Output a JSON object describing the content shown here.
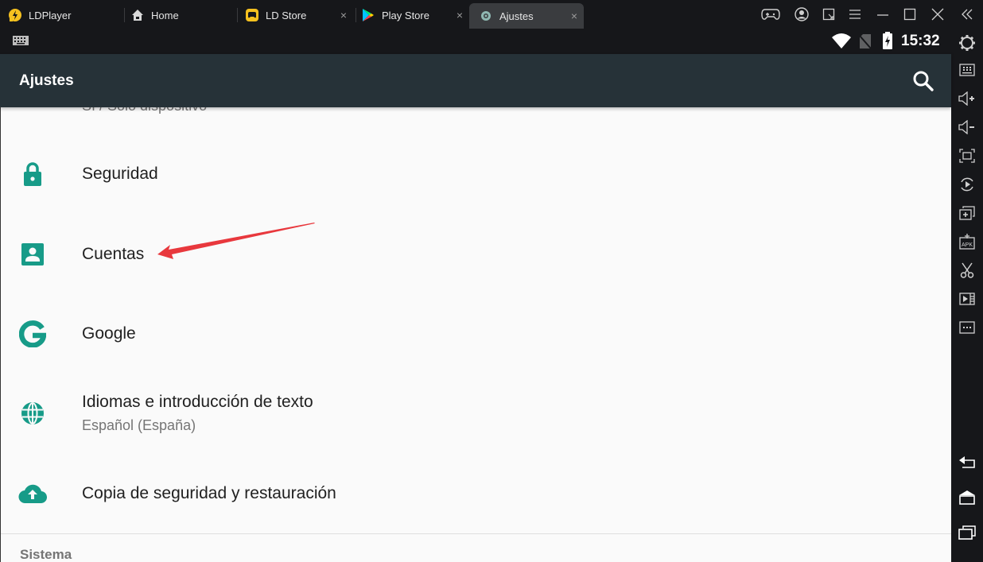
{
  "window": {
    "tabs": [
      {
        "label": "LDPlayer",
        "icon": "ldplayer-logo",
        "closable": false,
        "active": false
      },
      {
        "label": "Home",
        "icon": "home-icon",
        "closable": false,
        "active": false
      },
      {
        "label": "LD Store",
        "icon": "ld-store-icon",
        "closable": true,
        "active": false
      },
      {
        "label": "Play Store",
        "icon": "play-store-icon",
        "closable": true,
        "active": false
      },
      {
        "label": "Ajustes",
        "icon": "settings-app-icon",
        "closable": true,
        "active": true
      }
    ],
    "close_glyph": "×",
    "controls": [
      "gamepad-icon",
      "account-icon",
      "resize-icon",
      "menu-icon",
      "minimize-icon",
      "maximize-icon",
      "close-icon",
      "collapse-sidebar-icon"
    ]
  },
  "status": {
    "time": "15:32",
    "icons": [
      "wifi-icon",
      "no-sim-icon",
      "battery-charging-icon"
    ],
    "left_icon": "keyboard-icon"
  },
  "appbar": {
    "title": "Ajustes",
    "search_icon": "search-icon"
  },
  "settings": {
    "partial_top_text": "Sí / Solo dispositivo",
    "items": [
      {
        "title": "Seguridad",
        "icon": "lock-icon"
      },
      {
        "title": "Cuentas",
        "icon": "account-box-icon"
      },
      {
        "title": "Google",
        "icon": "google-icon"
      },
      {
        "title": "Idiomas e introducción de texto",
        "subtitle": "Español (España)",
        "icon": "globe-icon"
      },
      {
        "title": "Copia de seguridad y restauración",
        "icon": "cloud-upload-icon"
      }
    ],
    "section_header": "Sistema",
    "accent_color": "#179b88"
  },
  "annotation": {
    "arrow_color": "#e8383d",
    "target": "Cuentas"
  },
  "sidebar": {
    "top_items": [
      "settings-gear-icon",
      "keyboard-mapping-icon",
      "volume-up-icon",
      "volume-down-icon",
      "fullscreen-icon",
      "record-icon",
      "add-window-icon",
      "install-apk-icon",
      "screenshot-scissors-icon",
      "video-icon",
      "more-icon"
    ],
    "bottom_items": [
      "back-icon",
      "home-icon",
      "recents-icon"
    ]
  }
}
